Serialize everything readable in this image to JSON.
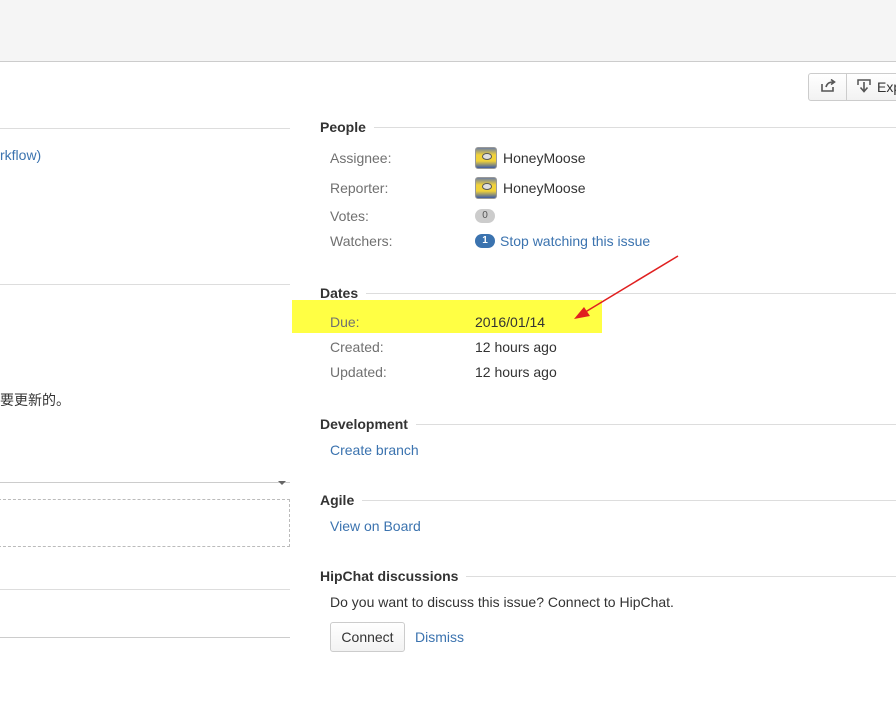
{
  "toolbar": {
    "export_label": "Exp"
  },
  "left": {
    "workflow_link": "rkflow)",
    "cjk_text": "要更新的。"
  },
  "people": {
    "heading": "People",
    "assignee_label": "Assignee:",
    "assignee_value": "HoneyMoose",
    "reporter_label": "Reporter:",
    "reporter_value": "HoneyMoose",
    "votes_label": "Votes:",
    "votes_count": "0",
    "watchers_label": "Watchers:",
    "watchers_count": "1",
    "watch_link": "Stop watching this issue"
  },
  "dates": {
    "heading": "Dates",
    "due_label": "Due:",
    "due_value": "2016/01/14",
    "created_label": "Created:",
    "created_value": "12 hours ago",
    "updated_label": "Updated:",
    "updated_value": "12 hours ago"
  },
  "development": {
    "heading": "Development",
    "create_branch": "Create branch"
  },
  "agile": {
    "heading": "Agile",
    "view_on_board": "View on Board"
  },
  "hipchat": {
    "heading": "HipChat discussions",
    "prompt": "Do you want to discuss this issue? Connect to HipChat.",
    "connect_label": "Connect",
    "dismiss_label": "Dismiss"
  },
  "colors": {
    "link": "#3b73af",
    "highlight": "#ffff44",
    "annotation_arrow": "#e02020"
  }
}
